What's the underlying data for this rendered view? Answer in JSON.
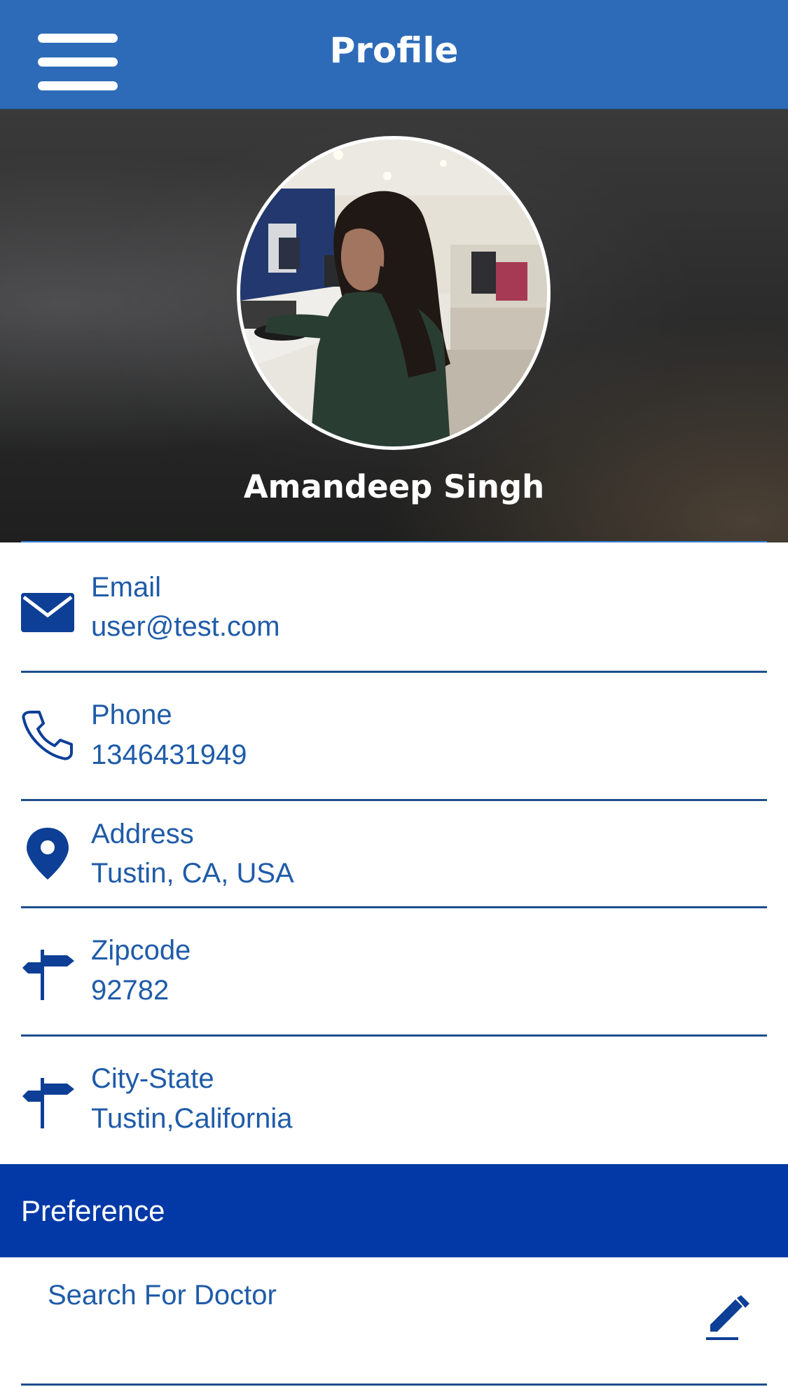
{
  "header": {
    "title": "Profile",
    "menu_icon": "hamburger-menu-icon",
    "background": "#2d6bb8"
  },
  "profile": {
    "name": "Amandeep Singh",
    "avatar_alt": "profile photo"
  },
  "fields": [
    {
      "icon": "envelope-icon",
      "label": "Email",
      "value": "user@test.com"
    },
    {
      "icon": "phone-icon",
      "label": "Phone",
      "value": "1346431949"
    },
    {
      "icon": "map-pin-icon",
      "label": "Address",
      "value": "Tustin, CA, USA"
    },
    {
      "icon": "signpost-icon",
      "label": "Zipcode",
      "value": "92782"
    },
    {
      "icon": "signpost-icon",
      "label": "City-State",
      "value": "Tustin,California"
    }
  ],
  "preference": {
    "title": "Preference",
    "background": "#0339a6",
    "items": [
      {
        "label": "Search For Doctor",
        "icon": "edit-pencil-icon"
      }
    ]
  },
  "colors": {
    "accent_text": "#1f5ba8",
    "icon": "#0d3f96",
    "divider": "#1e4f8c"
  }
}
